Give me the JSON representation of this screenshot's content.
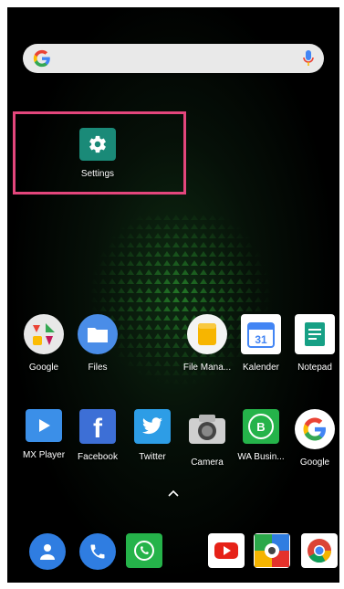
{
  "search_bar": {
    "logo": "G",
    "mic_icon": "mic-icon"
  },
  "highlighted_app": {
    "label": "Settings",
    "icon": "gear-icon",
    "color": "#1a8a78"
  },
  "row1": [
    {
      "label": "Google",
      "icon": "google-folder-icon"
    },
    {
      "label": "Files",
      "icon": "files-folder-icon"
    },
    {
      "label": "File Mana...",
      "icon": "file-manager-icon"
    },
    {
      "label": "Kalender",
      "icon": "calendar-icon",
      "day": "31"
    },
    {
      "label": "Notepad",
      "icon": "notepad-icon"
    }
  ],
  "row2": [
    {
      "label": "MX Player",
      "icon": "mx-player-icon"
    },
    {
      "label": "Facebook",
      "icon": "facebook-icon",
      "glyph": "f"
    },
    {
      "label": "Twitter",
      "icon": "twitter-icon"
    },
    {
      "label": "Camera",
      "icon": "camera-icon"
    },
    {
      "label": "WA Busin...",
      "icon": "wa-business-icon",
      "glyph": "B"
    },
    {
      "label": "Google",
      "icon": "google-icon",
      "glyph": "G"
    }
  ],
  "dock": [
    "contacts-icon",
    "phone-icon",
    "whatsapp-icon",
    "youtube-icon",
    "photo-app-icon",
    "chrome-icon"
  ],
  "drawer_handle": "chevron-up-icon",
  "colors": {
    "highlight": "#e3467c",
    "settings": "#1a8a78",
    "pattern": "#2ea032"
  }
}
